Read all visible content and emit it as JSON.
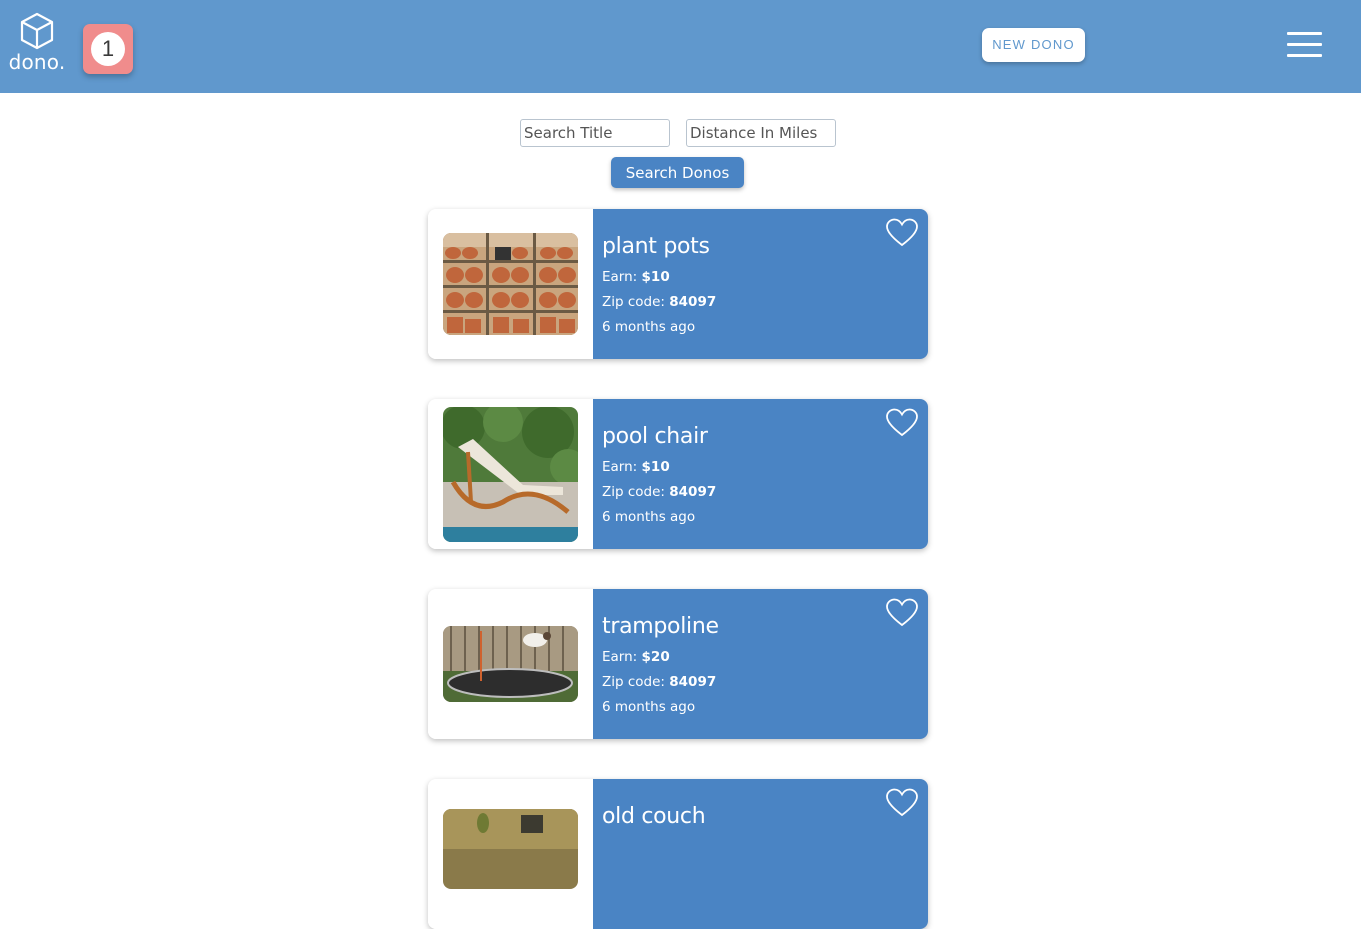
{
  "header": {
    "logo_text": "dono.",
    "notification_count": "1",
    "new_button_label": "NEW DONO"
  },
  "search": {
    "title_placeholder": "Search Title",
    "distance_placeholder": "Distance In Miles",
    "button_label": "Search Donos"
  },
  "labels": {
    "earn": "Earn:",
    "zip": "Zip code:"
  },
  "listings": [
    {
      "title": "plant pots",
      "earn": "$10",
      "zip": "84097",
      "posted": "6 months ago",
      "image": "terracotta-pots-on-shelves"
    },
    {
      "title": "pool chair",
      "earn": "$10",
      "zip": "84097",
      "posted": "6 months ago",
      "image": "wooden-lounge-chair-by-pool"
    },
    {
      "title": "trampoline",
      "earn": "$20",
      "zip": "84097",
      "posted": "6 months ago",
      "image": "dog-jumping-on-trampoline"
    },
    {
      "title": "old couch",
      "earn": "",
      "zip": "",
      "posted": "",
      "image": "living-room-interior"
    }
  ],
  "colors": {
    "header_bg": "#6098cd",
    "card_bg": "#4a84c4",
    "notification_bg": "#f08c8c",
    "button_bg": "#4a84c4"
  }
}
